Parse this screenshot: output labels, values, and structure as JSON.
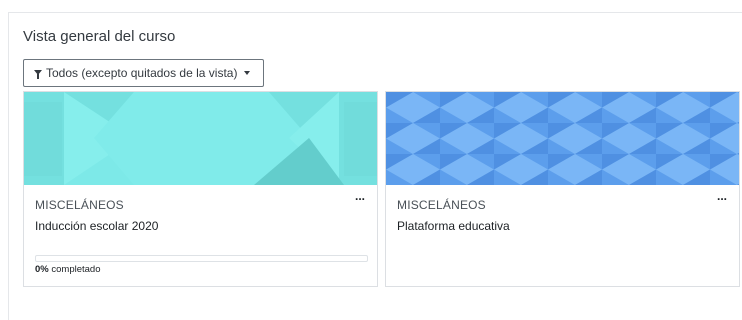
{
  "overview": {
    "title": "Vista general del curso",
    "filter_label": "Todos (excepto quitados de la vista)"
  },
  "courses": [
    {
      "category": "MISCELÁNEOS",
      "name": "Inducción escolar 2020",
      "menu_label": "...",
      "progress_percent": 0,
      "progress_value": "0%",
      "progress_suffix": "completado",
      "banner_colors": [
        "#7ce8e8",
        "#63d0cf",
        "#8ff0ef"
      ]
    },
    {
      "category": "MISCELÁNEOS",
      "name": "Plataforma educativa",
      "menu_label": "...",
      "banner_colors": [
        "#5ea1ee",
        "#78b5f5",
        "#4c8fe0"
      ]
    }
  ],
  "colors": {
    "accent": "#0f6cbf",
    "border": "#dcdfe3"
  }
}
